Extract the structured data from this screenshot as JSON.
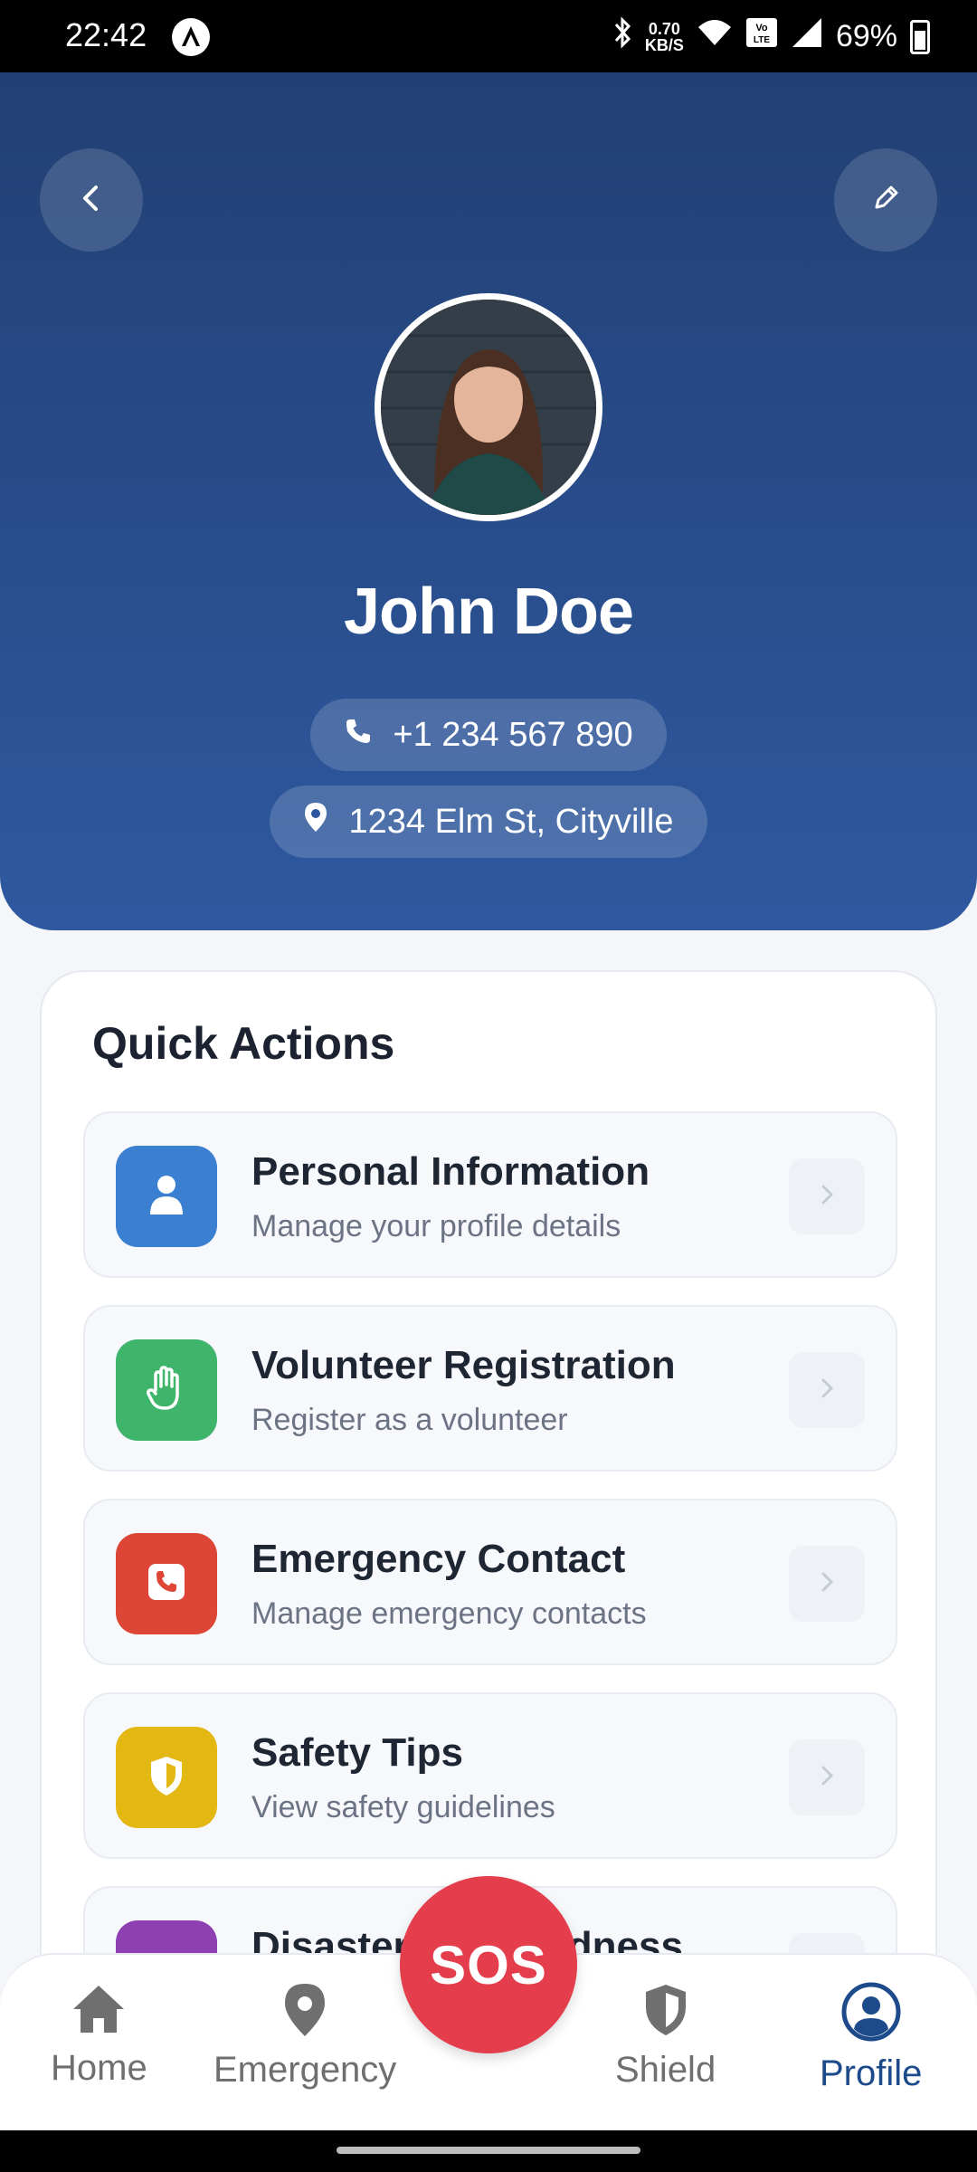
{
  "status_bar": {
    "time": "22:42",
    "net_speed_value": "0.70",
    "net_speed_unit": "KB/S",
    "battery": "69%"
  },
  "profile": {
    "name": "John Doe",
    "phone": "+1 234 567 890",
    "address": "1234 Elm St, Cityville"
  },
  "quick_actions": {
    "title": "Quick Actions",
    "items": [
      {
        "title": "Personal Information",
        "subtitle": "Manage your profile details",
        "color": "#3b7fd1",
        "icon": "user-icon"
      },
      {
        "title": "Volunteer Registration",
        "subtitle": "Register as a volunteer",
        "color": "#3fb56b",
        "icon": "hand-icon"
      },
      {
        "title": "Emergency Contact",
        "subtitle": "Manage emergency contacts",
        "color": "#dd4636",
        "icon": "phone-icon"
      },
      {
        "title": "Safety Tips",
        "subtitle": "View safety guidelines",
        "color": "#e3b812",
        "icon": "shield-icon"
      },
      {
        "title": "Disaster Preparedness",
        "subtitle": "",
        "color": "#8e3fb2",
        "icon": "book-icon"
      }
    ]
  },
  "bottom_nav": {
    "items": [
      {
        "label": "Home",
        "icon": "home-icon"
      },
      {
        "label": "Emergency",
        "icon": "location-pin-icon"
      },
      {
        "label": "Shield",
        "icon": "shield-icon"
      },
      {
        "label": "Profile",
        "icon": "profile-icon",
        "active": true
      }
    ],
    "sos_label": "SOS"
  },
  "colors": {
    "header_gradient_top": "#223f73",
    "header_gradient_bottom": "#2e59a0",
    "sos": "#e43d4b",
    "active_nav": "#1c4a8a"
  }
}
